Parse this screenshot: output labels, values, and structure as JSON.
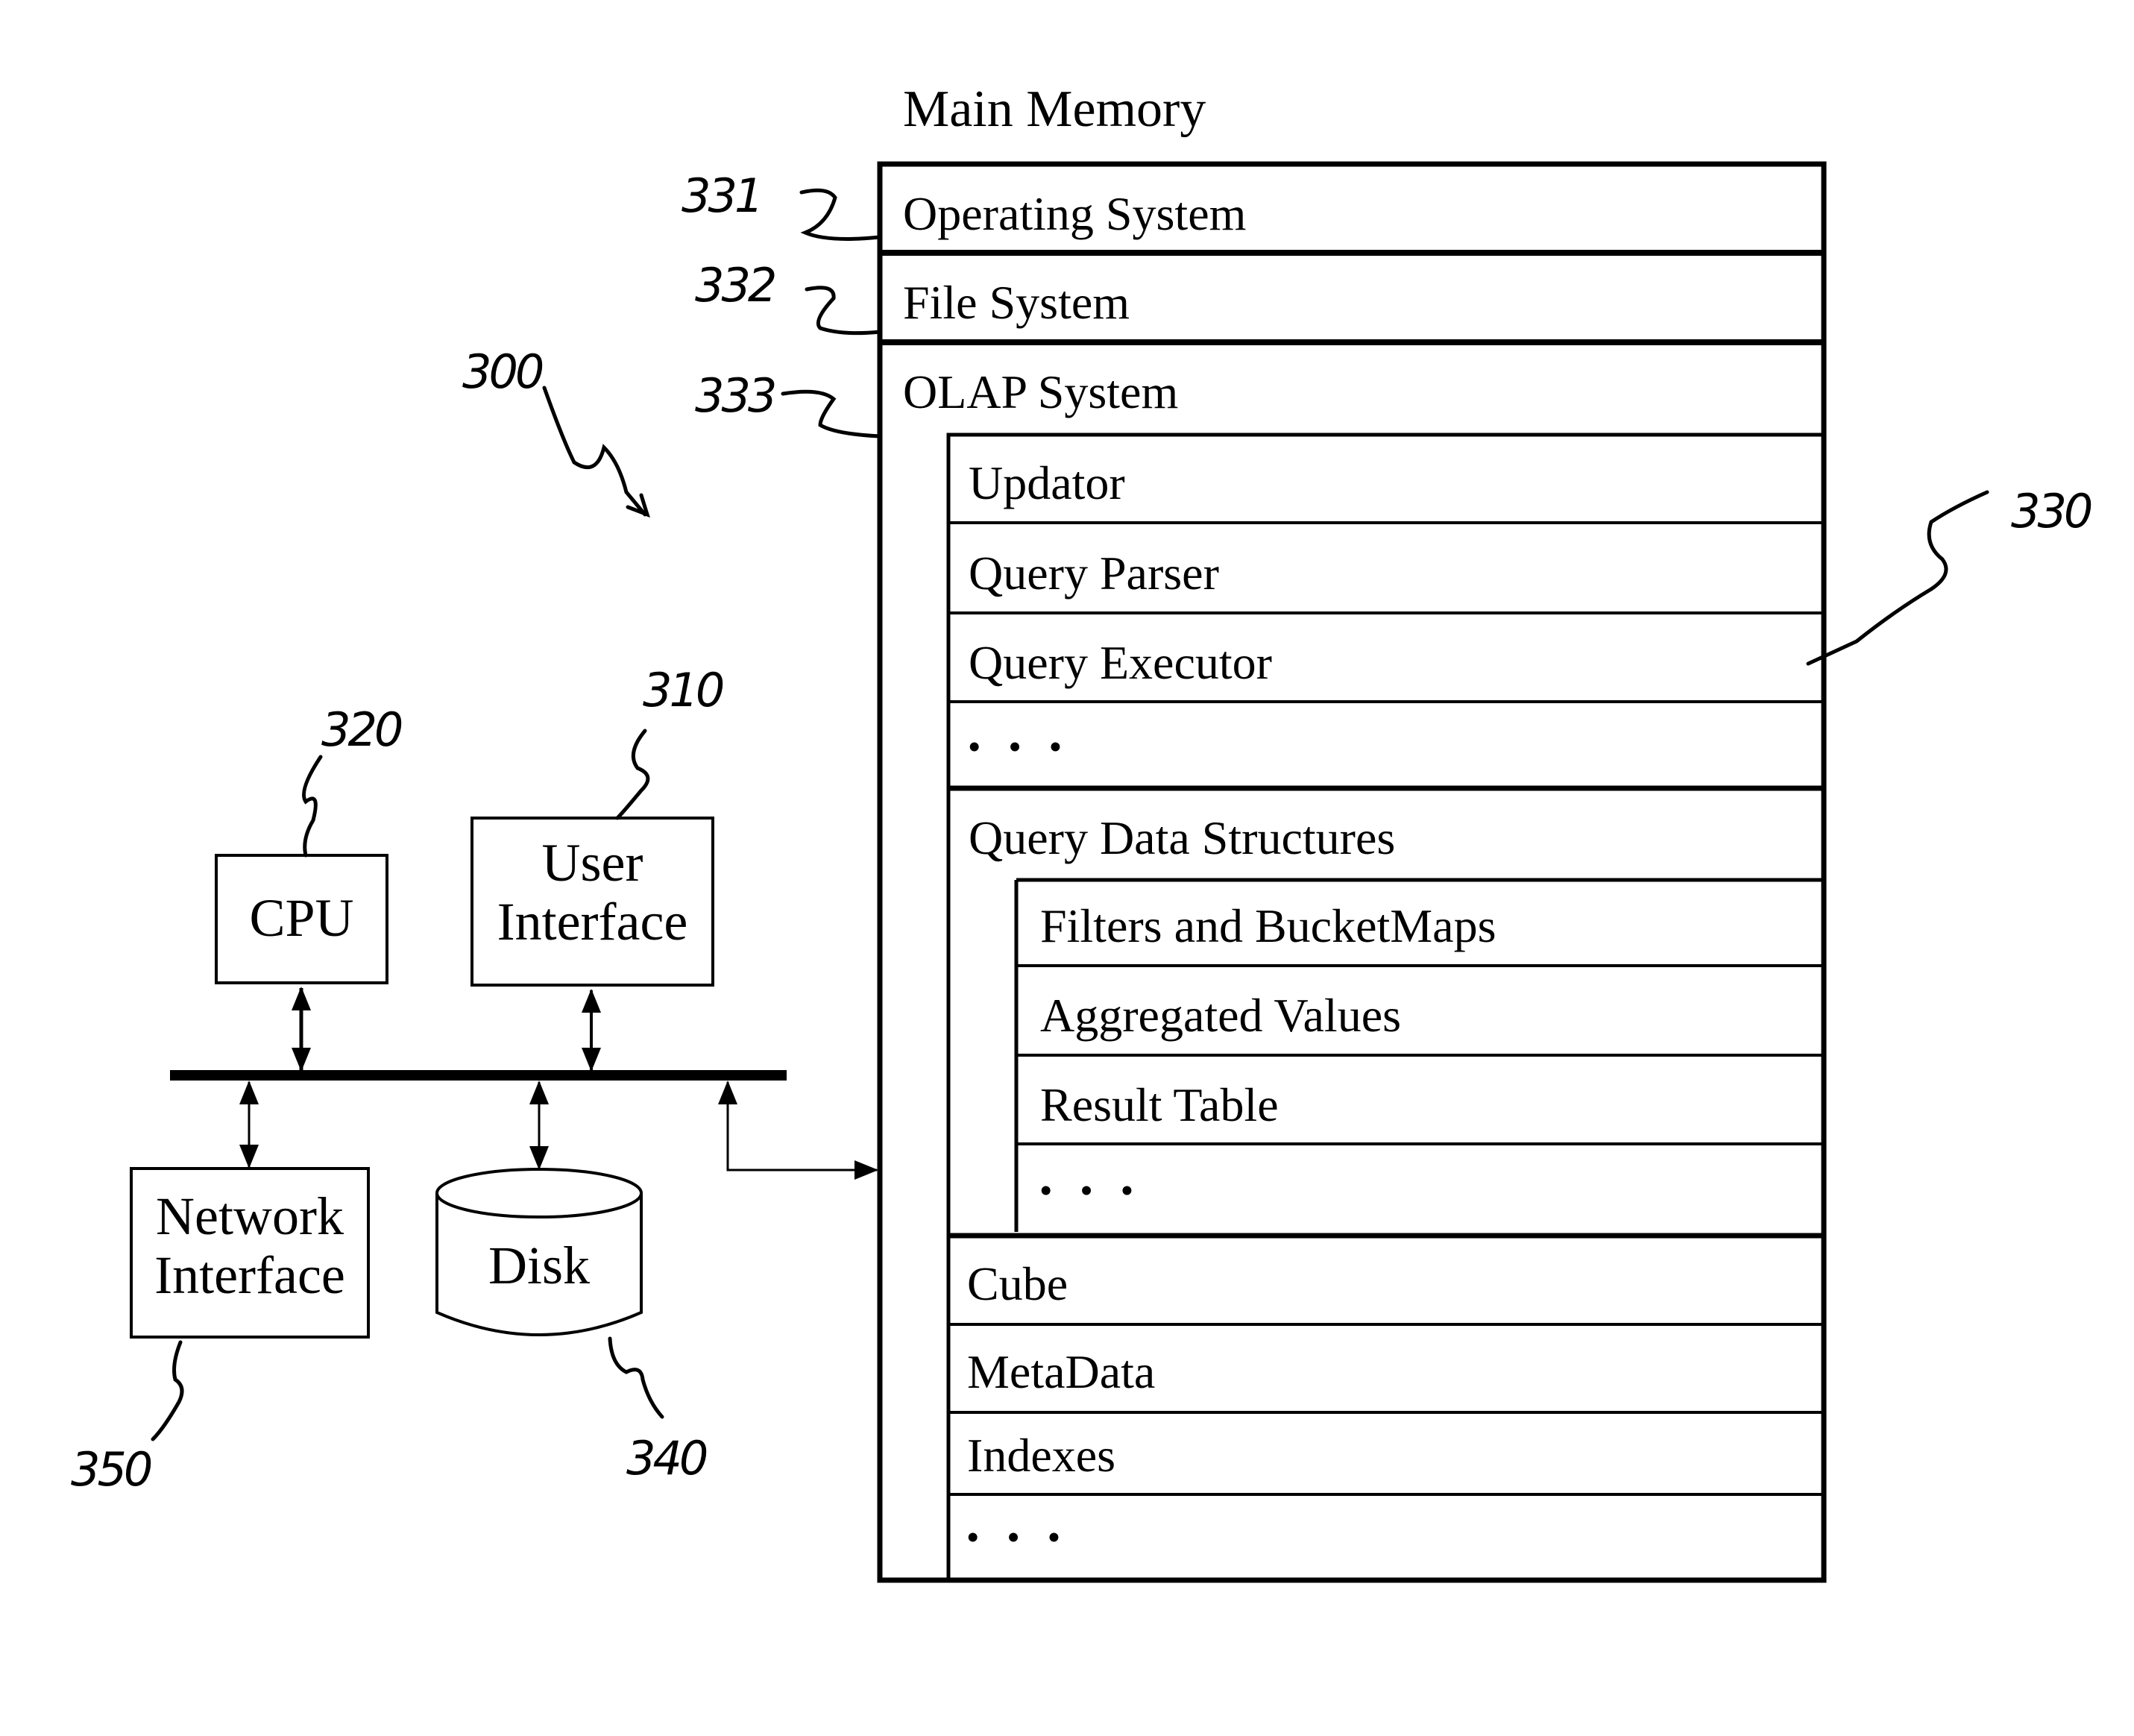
{
  "figure": {
    "reference_numerals": {
      "system": "300",
      "user_interface": "310",
      "cpu": "320",
      "main_memory_olap": "330",
      "operating_system": "331",
      "file_system": "332",
      "olap_system": "333",
      "disk": "340",
      "network_interface": "350"
    }
  },
  "hardware": {
    "cpu_label": "CPU",
    "user_interface_line1": "User",
    "user_interface_line2": "Interface",
    "network_interface_line1": "Network",
    "network_interface_line2": "Interface",
    "disk_label": "Disk"
  },
  "main_memory": {
    "title": "Main Memory",
    "operating_system": "Operating System",
    "file_system": "File System",
    "olap_system": {
      "label": "OLAP System",
      "components": [
        "Updator",
        "Query Parser",
        "Query Executor",
        "• • •"
      ],
      "query_data_structures": {
        "label": "Query Data Structures",
        "items": [
          "Filters and BucketMaps",
          "Aggregated Values",
          "Result Table",
          "• • •"
        ]
      },
      "data_items": [
        "Cube",
        "MetaData",
        "Indexes",
        "• • •"
      ]
    }
  }
}
